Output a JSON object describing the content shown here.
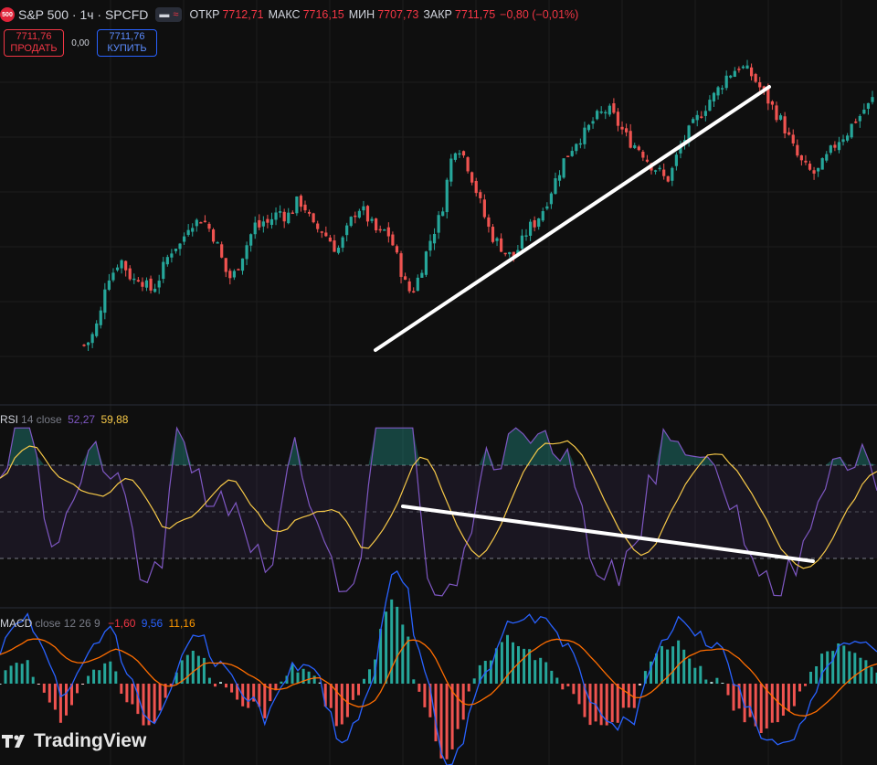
{
  "header": {
    "logo_text": "500",
    "title": "S&P 500 · 1ч · SPCFD",
    "pill_left": "▬",
    "pill_right": "≈",
    "open_label": "ОТКР",
    "open": "7712,71",
    "high_label": "МАКС",
    "high": "7716,15",
    "low_label": "МИН",
    "low": "7707,73",
    "close_label": "ЗАКР",
    "close": "7711,75",
    "change": "−0,80 (−0,01%)"
  },
  "trade": {
    "sell_price": "7711,76",
    "sell_label": "ПРОДАТЬ",
    "spread": "0,00",
    "buy_price": "7711,76",
    "buy_label": "КУПИТЬ"
  },
  "rsi": {
    "name": "RSI",
    "params": "14 close",
    "value": "52,27",
    "ma": "59,88",
    "line_color": "#7e57c2",
    "ma_color": "#f7c948"
  },
  "macd": {
    "name": "MACD",
    "params": "close 12 26 9",
    "hist": "−1,60",
    "macd": "9,56",
    "signal": "11,16",
    "macd_color": "#2962ff",
    "signal_color": "#ff6d00"
  },
  "brand": {
    "name": "TradingView"
  },
  "colors": {
    "up": "#26a69a",
    "down": "#ef5350",
    "background": "#0f0f0f"
  },
  "chart_data": {
    "type": "candlestick",
    "interval": "1h",
    "symbol": "SPCFD",
    "close_path": [
      0.17,
      0.18,
      0.2,
      0.23,
      0.27,
      0.36,
      0.38,
      0.39,
      0.42,
      0.42,
      0.39,
      0.37,
      0.36,
      0.38,
      0.35,
      0.34,
      0.33,
      0.36,
      0.38,
      0.42,
      0.44,
      0.47,
      0.46,
      0.48,
      0.52,
      0.54,
      0.53,
      0.55,
      0.54,
      0.52,
      0.5,
      0.47,
      0.43,
      0.39,
      0.37,
      0.38,
      0.41,
      0.44,
      0.47,
      0.5,
      0.53,
      0.52,
      0.54,
      0.53,
      0.55,
      0.56,
      0.57,
      0.55,
      0.56,
      0.58,
      0.6,
      0.59,
      0.57,
      0.53,
      0.51,
      0.52,
      0.5,
      0.49,
      0.47,
      0.45,
      0.47,
      0.5,
      0.53,
      0.56,
      0.58,
      0.57,
      0.55,
      0.53,
      0.51,
      0.5,
      0.51,
      0.5,
      0.47,
      0.43,
      0.39,
      0.35,
      0.33,
      0.34,
      0.37,
      0.41,
      0.45,
      0.49,
      0.52,
      0.55,
      0.6,
      0.68,
      0.74,
      0.77,
      0.75,
      0.72,
      0.69,
      0.65,
      0.61,
      0.57,
      0.53,
      0.5,
      0.48,
      0.47,
      0.45,
      0.44,
      0.43,
      0.45,
      0.47,
      0.5,
      0.52,
      0.53,
      0.55,
      0.57,
      0.6,
      0.63,
      0.66,
      0.69,
      0.72,
      0.74,
      0.76,
      0.78,
      0.79,
      0.8,
      0.82,
      0.84,
      0.85,
      0.86,
      0.87,
      0.86,
      0.84,
      0.82,
      0.8,
      0.78,
      0.77,
      0.76,
      0.75,
      0.73,
      0.71,
      0.7,
      0.69,
      0.67,
      0.66,
      0.68,
      0.72,
      0.75,
      0.78,
      0.8,
      0.82,
      0.84,
      0.86,
      0.88,
      0.9,
      0.91,
      0.93,
      0.95,
      0.97,
      0.98,
      0.99,
      1.0,
      0.99,
      0.98,
      0.97,
      0.95,
      0.93,
      0.91,
      0.89,
      0.87,
      0.85,
      0.83,
      0.8,
      0.77,
      0.74,
      0.72,
      0.7,
      0.69,
      0.68,
      0.68,
      0.7,
      0.72,
      0.74,
      0.76,
      0.78,
      0.79,
      0.8,
      0.82,
      0.84,
      0.85,
      0.87,
      0.88,
      0.9
    ]
  }
}
